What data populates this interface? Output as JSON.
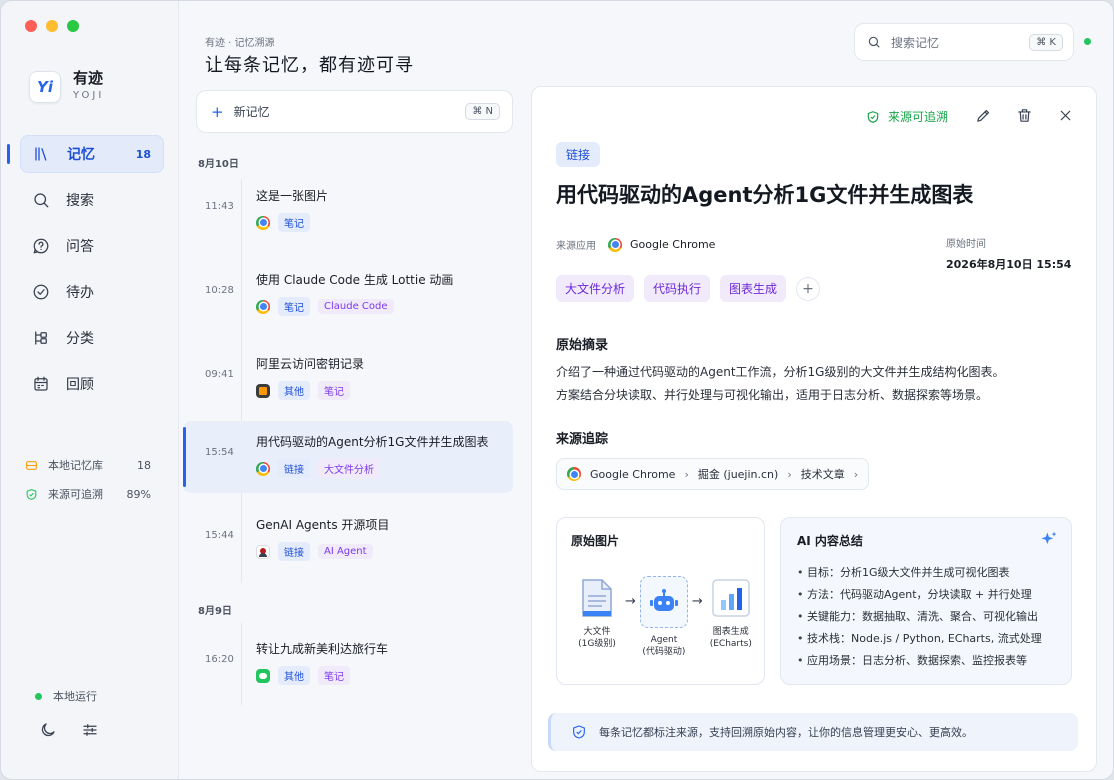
{
  "app": {
    "logo": "Yi",
    "name": "有迹",
    "name_en": "YOJI"
  },
  "window_controls": [
    {
      "name": "close",
      "color": "#ff5f57"
    },
    {
      "name": "minimize",
      "color": "#febc2e"
    },
    {
      "name": "zoom",
      "color": "#28c840"
    }
  ],
  "nav": [
    {
      "label": "记忆",
      "count": "18",
      "icon": "library-icon",
      "active": true
    },
    {
      "label": "搜索",
      "icon": "search-icon"
    },
    {
      "label": "问答",
      "icon": "question-icon"
    },
    {
      "label": "待办",
      "icon": "check-circle-icon"
    },
    {
      "label": "分类",
      "icon": "category-icon"
    },
    {
      "label": "回顾",
      "icon": "calendar-icon"
    }
  ],
  "sidebar_stats": [
    {
      "label": "本地记忆库",
      "value": "18",
      "icon": "database-icon",
      "color": "#f59e0b"
    },
    {
      "label": "来源可追溯",
      "value": "89%",
      "icon": "shield-check-icon",
      "color": "#22c55e"
    }
  ],
  "status": {
    "label": "本地运行",
    "color": "#22c55e"
  },
  "header": {
    "breadcrumb": "有迹 · 记忆溯源",
    "title": "让每条记忆，都有迹可寻"
  },
  "search": {
    "placeholder": "搜索记忆",
    "shortcut": "⌘ K"
  },
  "new_memory": {
    "label": "新记忆",
    "shortcut": "⌘ N"
  },
  "timeline": [
    {
      "date": "8月10日",
      "entries": [
        {
          "time": "11:43",
          "title": "这是一张图片",
          "app": "chrome",
          "tags": [
            {
              "text": "笔记",
              "color": "blue"
            }
          ]
        },
        {
          "time": "10:28",
          "title": "使用 Claude Code 生成 Lottie 动画",
          "app": "chrome",
          "tags": [
            {
              "text": "笔记",
              "color": "blue"
            },
            {
              "text": "Claude Code",
              "color": "purple"
            }
          ]
        },
        {
          "time": "09:41",
          "title": "阿里云访问密钥记录",
          "app": "sublime",
          "tags": [
            {
              "text": "其他",
              "color": "blue"
            },
            {
              "text": "笔记",
              "color": "purple"
            }
          ]
        },
        {
          "time": "15:54",
          "title": "用代码驱动的Agent分析1G文件并生成图表",
          "app": "chrome",
          "active": true,
          "tags": [
            {
              "text": "链接",
              "color": "blue"
            },
            {
              "text": "大文件分析",
              "color": "purple"
            }
          ]
        },
        {
          "time": "15:44",
          "title": "GenAI Agents 开源项目",
          "app": "github",
          "tags": [
            {
              "text": "链接",
              "color": "blue"
            },
            {
              "text": "AI Agent",
              "color": "purple"
            }
          ]
        }
      ]
    },
    {
      "date": "8月9日",
      "entries": [
        {
          "time": "16:20",
          "title": "转让九成新美利达旅行车",
          "app": "wechat",
          "tags": [
            {
              "text": "其他",
              "color": "blue"
            },
            {
              "text": "笔记",
              "color": "purple"
            }
          ]
        }
      ]
    }
  ],
  "detail": {
    "traceable": "来源可追溯",
    "type_tag": "链接",
    "title": "用代码驱动的Agent分析1G文件并生成图表",
    "source_label": "来源应用",
    "source_app": "Google Chrome",
    "time_label": "原始时间",
    "time_value": "2026年8月10日 15:54",
    "tags": [
      "大文件分析",
      "代码执行",
      "图表生成"
    ],
    "add_tag": "+",
    "excerpt_heading": "原始摘录",
    "excerpt": [
      "介绍了一种通过代码驱动的Agent工作流，分析1G级别的大文件并生成结构化图表。",
      "方案结合分块读取、并行处理与可视化输出，适用于日志分析、数据探索等场景。"
    ],
    "trace_heading": "来源追踪",
    "trace_path": [
      "Google Chrome",
      "掘金 (juejin.cn)",
      "技术文章"
    ],
    "image_card": {
      "heading": "原始图片",
      "nodes": [
        {
          "label": "大文件",
          "sub": "(1G级别)"
        },
        {
          "label": "Agent",
          "sub": "(代码驱动)"
        },
        {
          "label": "图表生成",
          "sub": "(ECharts)"
        }
      ],
      "arrow": "→"
    },
    "ai_card": {
      "heading": "AI 内容总结",
      "items": [
        "目标：分析1G级大文件并生成可视化图表",
        "方法：代码驱动Agent，分块读取 + 并行处理",
        "关键能力：数据抽取、清洗、聚合、可视化输出",
        "技术栈：Node.js / Python, ECharts, 流式处理",
        "应用场景：日志分析、数据探索、监控报表等"
      ]
    },
    "footer": "每条记忆都标注来源，支持回溯原始内容，让你的信息管理更安心、更高效。"
  },
  "colors": {
    "accent": "#2563eb",
    "success": "#16a34a",
    "purple_tag": "#7c3aed"
  }
}
